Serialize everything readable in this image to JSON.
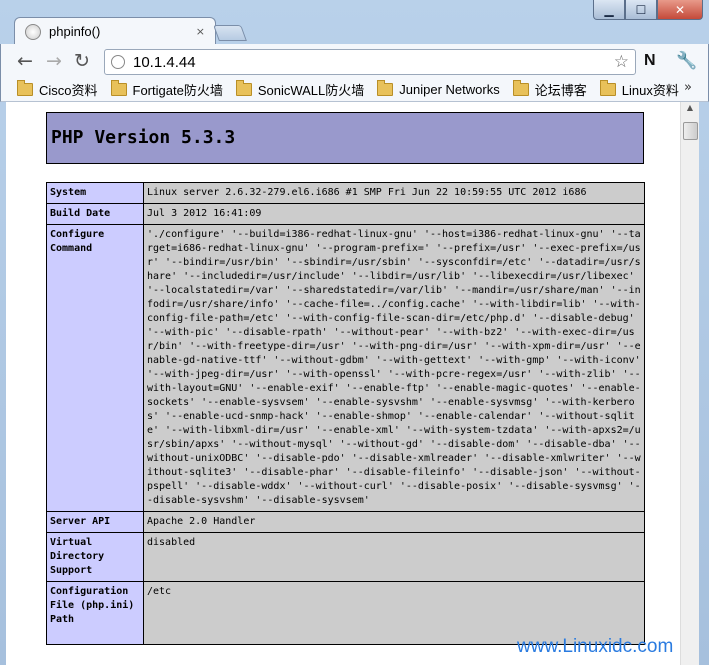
{
  "window": {
    "min_glyph": "▁",
    "max_glyph": "☐",
    "close_glyph": "✕"
  },
  "tab": {
    "title": "phpinfo()",
    "close_glyph": "×"
  },
  "nav": {
    "back_glyph": "←",
    "forward_glyph": "→",
    "reload_glyph": "↻",
    "url": "10.1.4.44",
    "star_glyph": "☆",
    "extension_label": "N",
    "wrench_glyph": "🔧"
  },
  "bookmarks": {
    "items": [
      "Cisco资料",
      "Fortigate防火墙",
      "SonicWALL防火墙",
      "Juniper Networks",
      "论坛博客",
      "Linux资料"
    ],
    "more_glyph": "»"
  },
  "page": {
    "title": "PHP Version 5.3.3",
    "rows": [
      {
        "key": "System",
        "value": "Linux server 2.6.32-279.el6.i686 #1 SMP Fri Jun 22 10:59:55 UTC 2012 i686"
      },
      {
        "key": "Build Date",
        "value": "Jul 3 2012 16:41:09"
      },
      {
        "key": "Configure Command",
        "value": "'./configure' '--build=i386-redhat-linux-gnu' '--host=i386-redhat-linux-gnu' '--target=i686-redhat-linux-gnu' '--program-prefix=' '--prefix=/usr' '--exec-prefix=/usr' '--bindir=/usr/bin' '--sbindir=/usr/sbin' '--sysconfdir=/etc' '--datadir=/usr/share' '--includedir=/usr/include' '--libdir=/usr/lib' '--libexecdir=/usr/libexec' '--localstatedir=/var' '--sharedstatedir=/var/lib' '--mandir=/usr/share/man' '--infodir=/usr/share/info' '--cache-file=../config.cache' '--with-libdir=lib' '--with-config-file-path=/etc' '--with-config-file-scan-dir=/etc/php.d' '--disable-debug' '--with-pic' '--disable-rpath' '--without-pear' '--with-bz2' '--with-exec-dir=/usr/bin' '--with-freetype-dir=/usr' '--with-png-dir=/usr' '--with-xpm-dir=/usr' '--enable-gd-native-ttf' '--without-gdbm' '--with-gettext' '--with-gmp' '--with-iconv' '--with-jpeg-dir=/usr' '--with-openssl' '--with-pcre-regex=/usr' '--with-zlib' '--with-layout=GNU' '--enable-exif' '--enable-ftp' '--enable-magic-quotes' '--enable-sockets' '--enable-sysvsem' '--enable-sysvshm' '--enable-sysvmsg' '--with-kerberos' '--enable-ucd-snmp-hack' '--enable-shmop' '--enable-calendar' '--without-sqlite' '--with-libxml-dir=/usr' '--enable-xml' '--with-system-tzdata' '--with-apxs2=/usr/sbin/apxs' '--without-mysql' '--without-gd' '--disable-dom' '--disable-dba' '--without-unixODBC' '--disable-pdo' '--disable-xmlreader' '--disable-xmlwriter' '--without-sqlite3' '--disable-phar' '--disable-fileinfo' '--disable-json' '--without-pspell' '--disable-wddx' '--without-curl' '--disable-posix' '--disable-sysvmsg' '--disable-sysvshm' '--disable-sysvsem'"
      },
      {
        "key": "Server API",
        "value": "Apache 2.0 Handler"
      },
      {
        "key": "Virtual Directory Support",
        "value": "disabled"
      },
      {
        "key": "Configuration File (php.ini) Path",
        "value": "/etc"
      }
    ]
  },
  "watermark": "www.Linuxidc.com",
  "colors": {
    "header_bg": "#9999cc",
    "key_bg": "#ccccff",
    "value_bg": "#cccccc",
    "watermark": "#2a7be0"
  }
}
